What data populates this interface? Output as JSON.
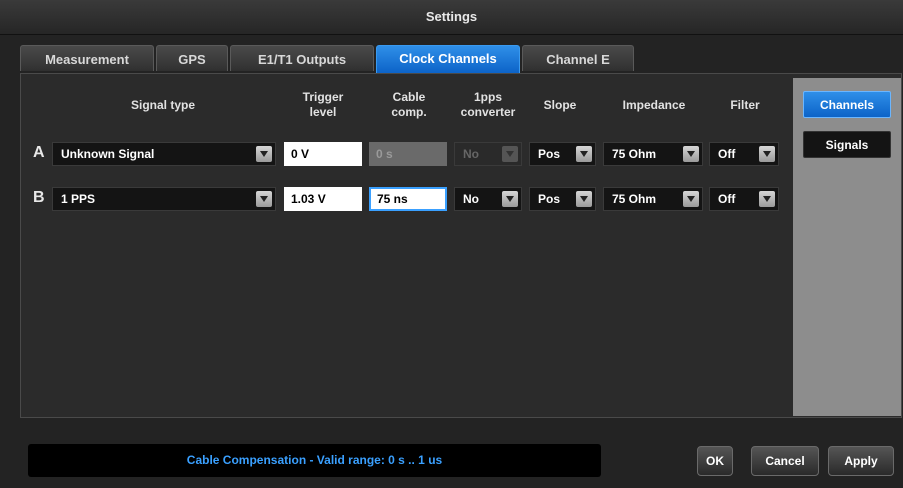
{
  "window": {
    "title": "Settings"
  },
  "tabs": [
    {
      "label": "Measurement"
    },
    {
      "label": "GPS"
    },
    {
      "label": "E1/T1 Outputs"
    },
    {
      "label": "Clock Channels"
    },
    {
      "label": "Channel E"
    }
  ],
  "active_tab": "Clock Channels",
  "columns": {
    "signal_type": "Signal type",
    "trigger_level": "Trigger\nlevel",
    "cable_comp": "Cable\ncomp.",
    "pps_converter": "1pps\nconverter",
    "slope": "Slope",
    "impedance": "Impedance",
    "filter": "Filter"
  },
  "rows": [
    {
      "label": "A",
      "signal_type": "Unknown Signal",
      "trigger_level": "0 V",
      "cable_comp": "0 s",
      "pps_converter": "No",
      "slope": "Pos",
      "impedance": "75 Ohm",
      "filter": "Off"
    },
    {
      "label": "B",
      "signal_type": "1 PPS",
      "trigger_level": "1.03 V",
      "cable_comp": "75 ns",
      "pps_converter": "No",
      "slope": "Pos",
      "impedance": "75 Ohm",
      "filter": "Off"
    }
  ],
  "side": {
    "channels": "Channels",
    "signals": "Signals"
  },
  "status": "Cable Compensation - Valid range: 0 s .. 1 us",
  "buttons": {
    "ok": "OK",
    "cancel": "Cancel",
    "apply": "Apply"
  },
  "colors": {
    "accent": "#1a7ae0",
    "status_text": "#3aa0ff"
  }
}
